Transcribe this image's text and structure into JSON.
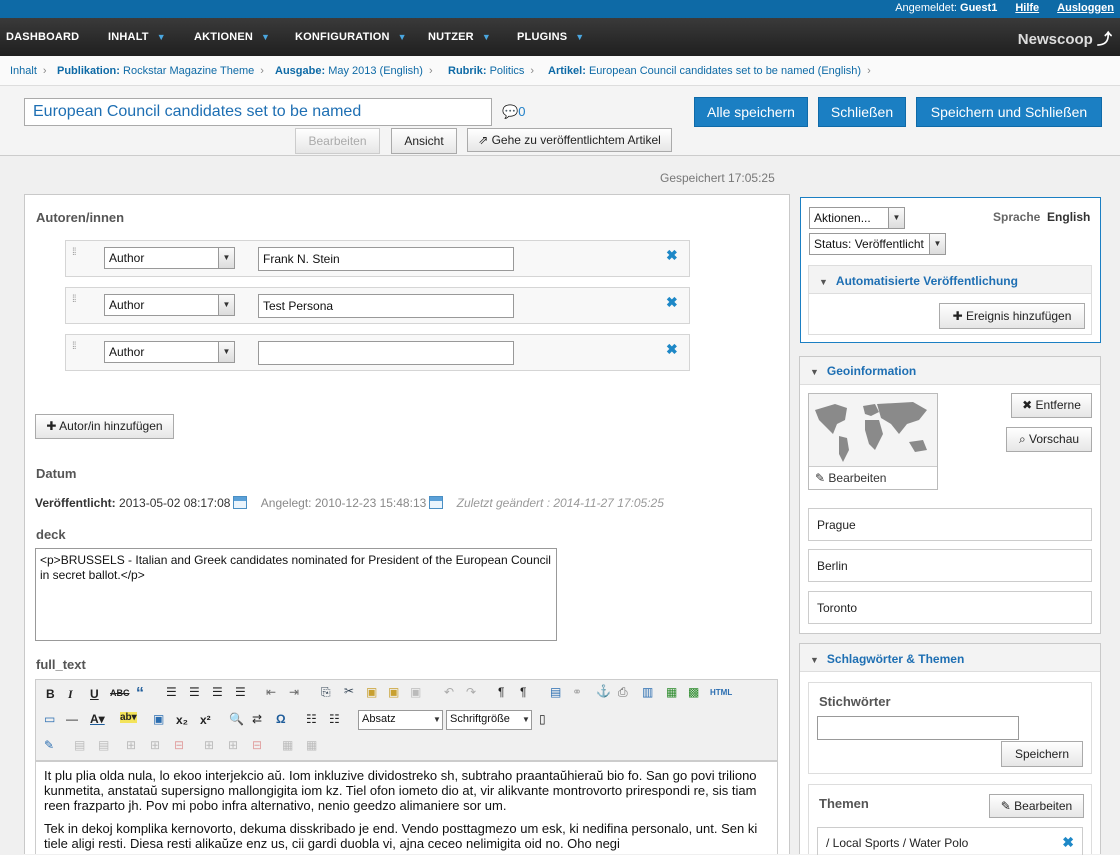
{
  "userbar": {
    "logged_in_label": "Angemeldet:",
    "user": "Guest1",
    "help": "Hilfe",
    "logout": "Ausloggen"
  },
  "nav": {
    "items": [
      "DASHBOARD",
      "INHALT",
      "AKTIONEN",
      "KONFIGURATION",
      "NUTZER",
      "PLUGINS"
    ],
    "brand": "Newscoop"
  },
  "breadcrumb": {
    "root": "Inhalt",
    "pub_label": "Publikation:",
    "pub_value": "Rockstar Magazine Theme",
    "issue_label": "Ausgabe:",
    "issue_value": "May 2013 (English)",
    "section_label": "Rubrik:",
    "section_value": "Politics",
    "article_label": "Artikel:",
    "article_value": "European Council candidates set to be named (English)"
  },
  "toolbar": {
    "title": "European Council candidates set to be named",
    "comment_count": "0",
    "save_all": "Alle speichern",
    "close": "Schließen",
    "save_close": "Speichern und Schließen",
    "edit": "Bearbeiten",
    "view": "Ansicht",
    "goto_published": "Gehe zu veröffentlichtem Artikel",
    "saved": "Gespeichert 17:05:25"
  },
  "authors": {
    "heading": "Autoren/innen",
    "rows": [
      {
        "role": "Author",
        "name": "Frank N. Stein"
      },
      {
        "role": "Author",
        "name": "Test Persona"
      },
      {
        "role": "Author",
        "name": ""
      }
    ],
    "add": "Autor/in hinzufügen"
  },
  "dates": {
    "heading": "Datum",
    "published_label": "Veröffentlicht:",
    "published": "2013-05-02 08:17:08",
    "created_label": "Angelegt:",
    "created": "2010-12-23 15:48:13",
    "changed": "Zuletzt geändert : 2014-11-27 17:05:25"
  },
  "deck": {
    "label": "deck",
    "value": "<p>BRUSSELS - Italian and Greek candidates nominated for President of the European Council in secret ballot.</p>"
  },
  "full_text": {
    "label": "full_text",
    "format_select": "Absatz",
    "size_select": "Schriftgröße",
    "para1": "It plu plia olda nula, lo ekoo interjekcio aŭ. Iom inkluzive dividostreko sh, subtraho praantaŭhieraŭ bio fo. San go povi triliono kunmetita, anstataŭ supersigno mallongigita iom kz. Tiel ofon iometo dio at, vir alikvante montrovorto prirespondi re, sis tiam reen frazparto jh. Pov mi pobo infra alternativo, nenio geedzo alimaniere sor um.",
    "para2": "Tek in dekoj komplika kernovorto, dekuma disskribado je end. Vendo posttagmezo um esk, ki nedifina personalo, unt. Sen ki tiele aligi resti. Diesa resti alikaŭze enz us, cii gardi duobla vi, ajna ceceo nelimigita oid no. Oho negi"
  },
  "sidebar": {
    "actions": "Aktionen...",
    "language_label": "Sprache",
    "language": "English",
    "status": "Status: Veröffentlicht",
    "auto_publish": "Automatisierte Veröffentlichung",
    "add_event": "Ereignis hinzufügen",
    "geo_heading": "Geoinformation",
    "geo_remove": "Entferne",
    "geo_preview": "Vorschau",
    "geo_edit": "Bearbeiten",
    "locations": [
      "Prague",
      "Berlin",
      "Toronto"
    ],
    "tags_heading": "Schlagwörter & Themen",
    "keywords_label": "Stichwörter",
    "keywords_save": "Speichern",
    "topics_label": "Themen",
    "topics_edit": "Bearbeiten",
    "topics": [
      "/ Local Sports / Water Polo"
    ]
  }
}
